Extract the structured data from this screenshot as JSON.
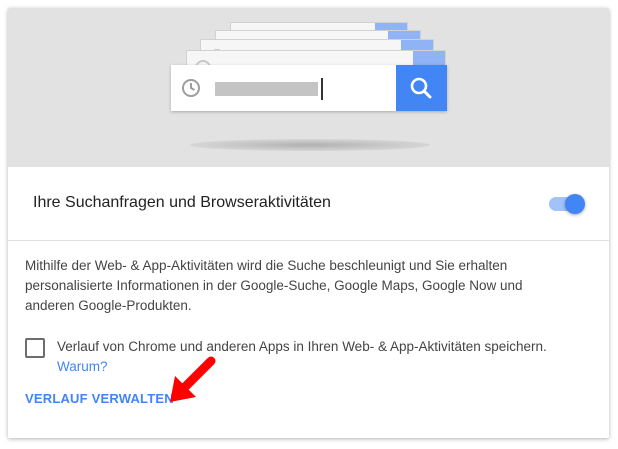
{
  "hero": {
    "search_icon": "search-icon",
    "history_icon": "clock-icon"
  },
  "setting": {
    "title": "Ihre Suchanfragen und Browseraktivitäten",
    "toggle_state": "on",
    "description": "Mithilfe der Web- & App-Aktivitäten wird die Suche beschleunigt und Sie erhalten personalisierte Informationen in der Google-Suche, Google Maps, Google Now und anderen Google-Produkten.",
    "checkbox_label": "Verlauf von Chrome und anderen Apps in Ihren Web- & App-Aktivitäten speichern.",
    "checkbox_checked": false,
    "why_link": "Warum?",
    "manage_link": "VERLAUF VERWALTEN"
  },
  "colors": {
    "accent": "#4285f4",
    "hero_bg": "#e2e2e2",
    "arrow": "#ff0000"
  }
}
